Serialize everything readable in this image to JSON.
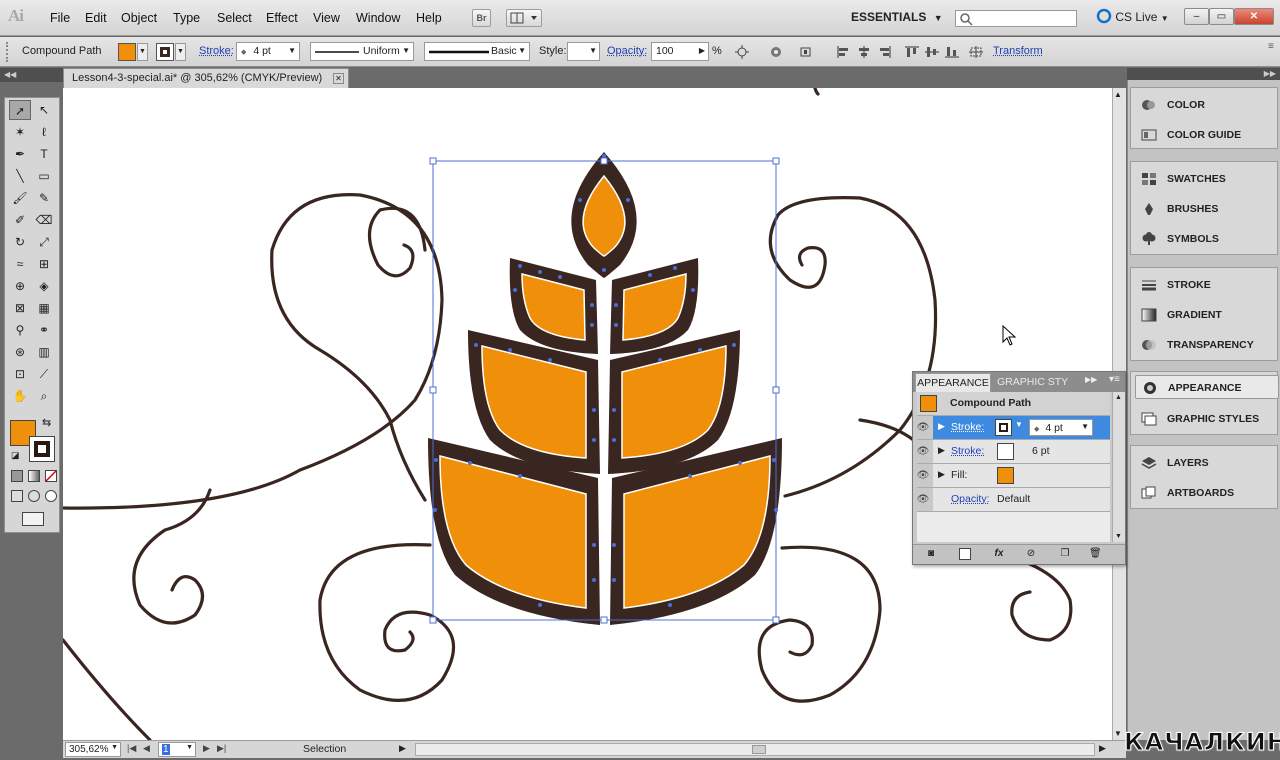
{
  "app": {
    "logo": "Ai"
  },
  "menu": [
    "File",
    "Edit",
    "Object",
    "Type",
    "Select",
    "Effect",
    "View",
    "Window",
    "Help"
  ],
  "menubar": {
    "bridge_label": "Br",
    "workspace": "ESSENTIALS",
    "search_placeholder": "",
    "cs_live": "CS Live"
  },
  "window_controls": {
    "minimize": "–",
    "restore": "▭",
    "close": "✕"
  },
  "control": {
    "selection_type": "Compound Path",
    "fill_color": "#f0900a",
    "stroke_color": "#3a2620",
    "stroke_label": "Stroke:",
    "stroke_weight": "4 pt",
    "profile": "Uniform",
    "brush": "Basic",
    "style_label": "Style:",
    "opacity_label": "Opacity:",
    "opacity_value": "100",
    "opacity_unit": "%",
    "transform_label": "Transform"
  },
  "document": {
    "tab_title": "Lesson4-3-special.ai* @ 305,62% (CMYK/Preview)"
  },
  "status": {
    "zoom": "305,62%",
    "artboard": "1",
    "tool": "Selection"
  },
  "tools": [
    [
      "selection-tool",
      "➚"
    ],
    [
      "direct-selection-tool",
      "↖"
    ],
    [
      "magic-wand-tool",
      "✶"
    ],
    [
      "lasso-tool",
      "ℓ"
    ],
    [
      "pen-tool",
      "✒"
    ],
    [
      "type-tool",
      "T"
    ],
    [
      "line-tool",
      "╲"
    ],
    [
      "rectangle-tool",
      "▭"
    ],
    [
      "paintbrush-tool",
      "🖌"
    ],
    [
      "pencil-tool",
      "✎"
    ],
    [
      "blob-brush-tool",
      "✐"
    ],
    [
      "eraser-tool",
      "⌫"
    ],
    [
      "rotate-tool",
      "↻"
    ],
    [
      "scale-tool",
      "⤢"
    ],
    [
      "warp-tool",
      "≈"
    ],
    [
      "free-transform-tool",
      "⊞"
    ],
    [
      "shape-builder-tool",
      "⊕"
    ],
    [
      "live-paint-tool",
      "◈"
    ],
    [
      "mesh-tool",
      "⊠"
    ],
    [
      "gradient-tool",
      "▦"
    ],
    [
      "eyedropper-tool",
      "⚲"
    ],
    [
      "blend-tool",
      "⚭"
    ],
    [
      "symbol-sprayer-tool",
      "⊛"
    ],
    [
      "column-graph-tool",
      "▥"
    ],
    [
      "artboard-tool",
      "⊡"
    ],
    [
      "slice-tool",
      "⟋"
    ],
    [
      "hand-tool",
      "✋"
    ],
    [
      "zoom-tool",
      "⌕"
    ]
  ],
  "panels": {
    "group1": [
      "COLOR",
      "COLOR GUIDE"
    ],
    "group2": [
      "SWATCHES",
      "BRUSHES",
      "SYMBOLS"
    ],
    "group3": [
      "STROKE",
      "GRADIENT",
      "TRANSPARENCY"
    ],
    "group4": [
      "APPEARANCE",
      "GRAPHIC STYLES"
    ],
    "group5": [
      "LAYERS",
      "ARTBOARDS"
    ]
  },
  "appearance": {
    "tab_active": "APPEARANCE",
    "tab_other": "GRAPHIC STY",
    "header": "Compound Path",
    "header_color": "#f0900a",
    "stroke1_label": "Stroke:",
    "stroke1_value": "4 pt",
    "stroke1_color": "#3a2620",
    "stroke2_label": "Stroke:",
    "stroke2_value": "6 pt",
    "stroke2_color": "#ffffff",
    "fill_label": "Fill:",
    "fill_color": "#f0900a",
    "opacity_label": "Opacity:",
    "opacity_value": "Default"
  },
  "watermark": "КАЧАЛКИН.РУ"
}
